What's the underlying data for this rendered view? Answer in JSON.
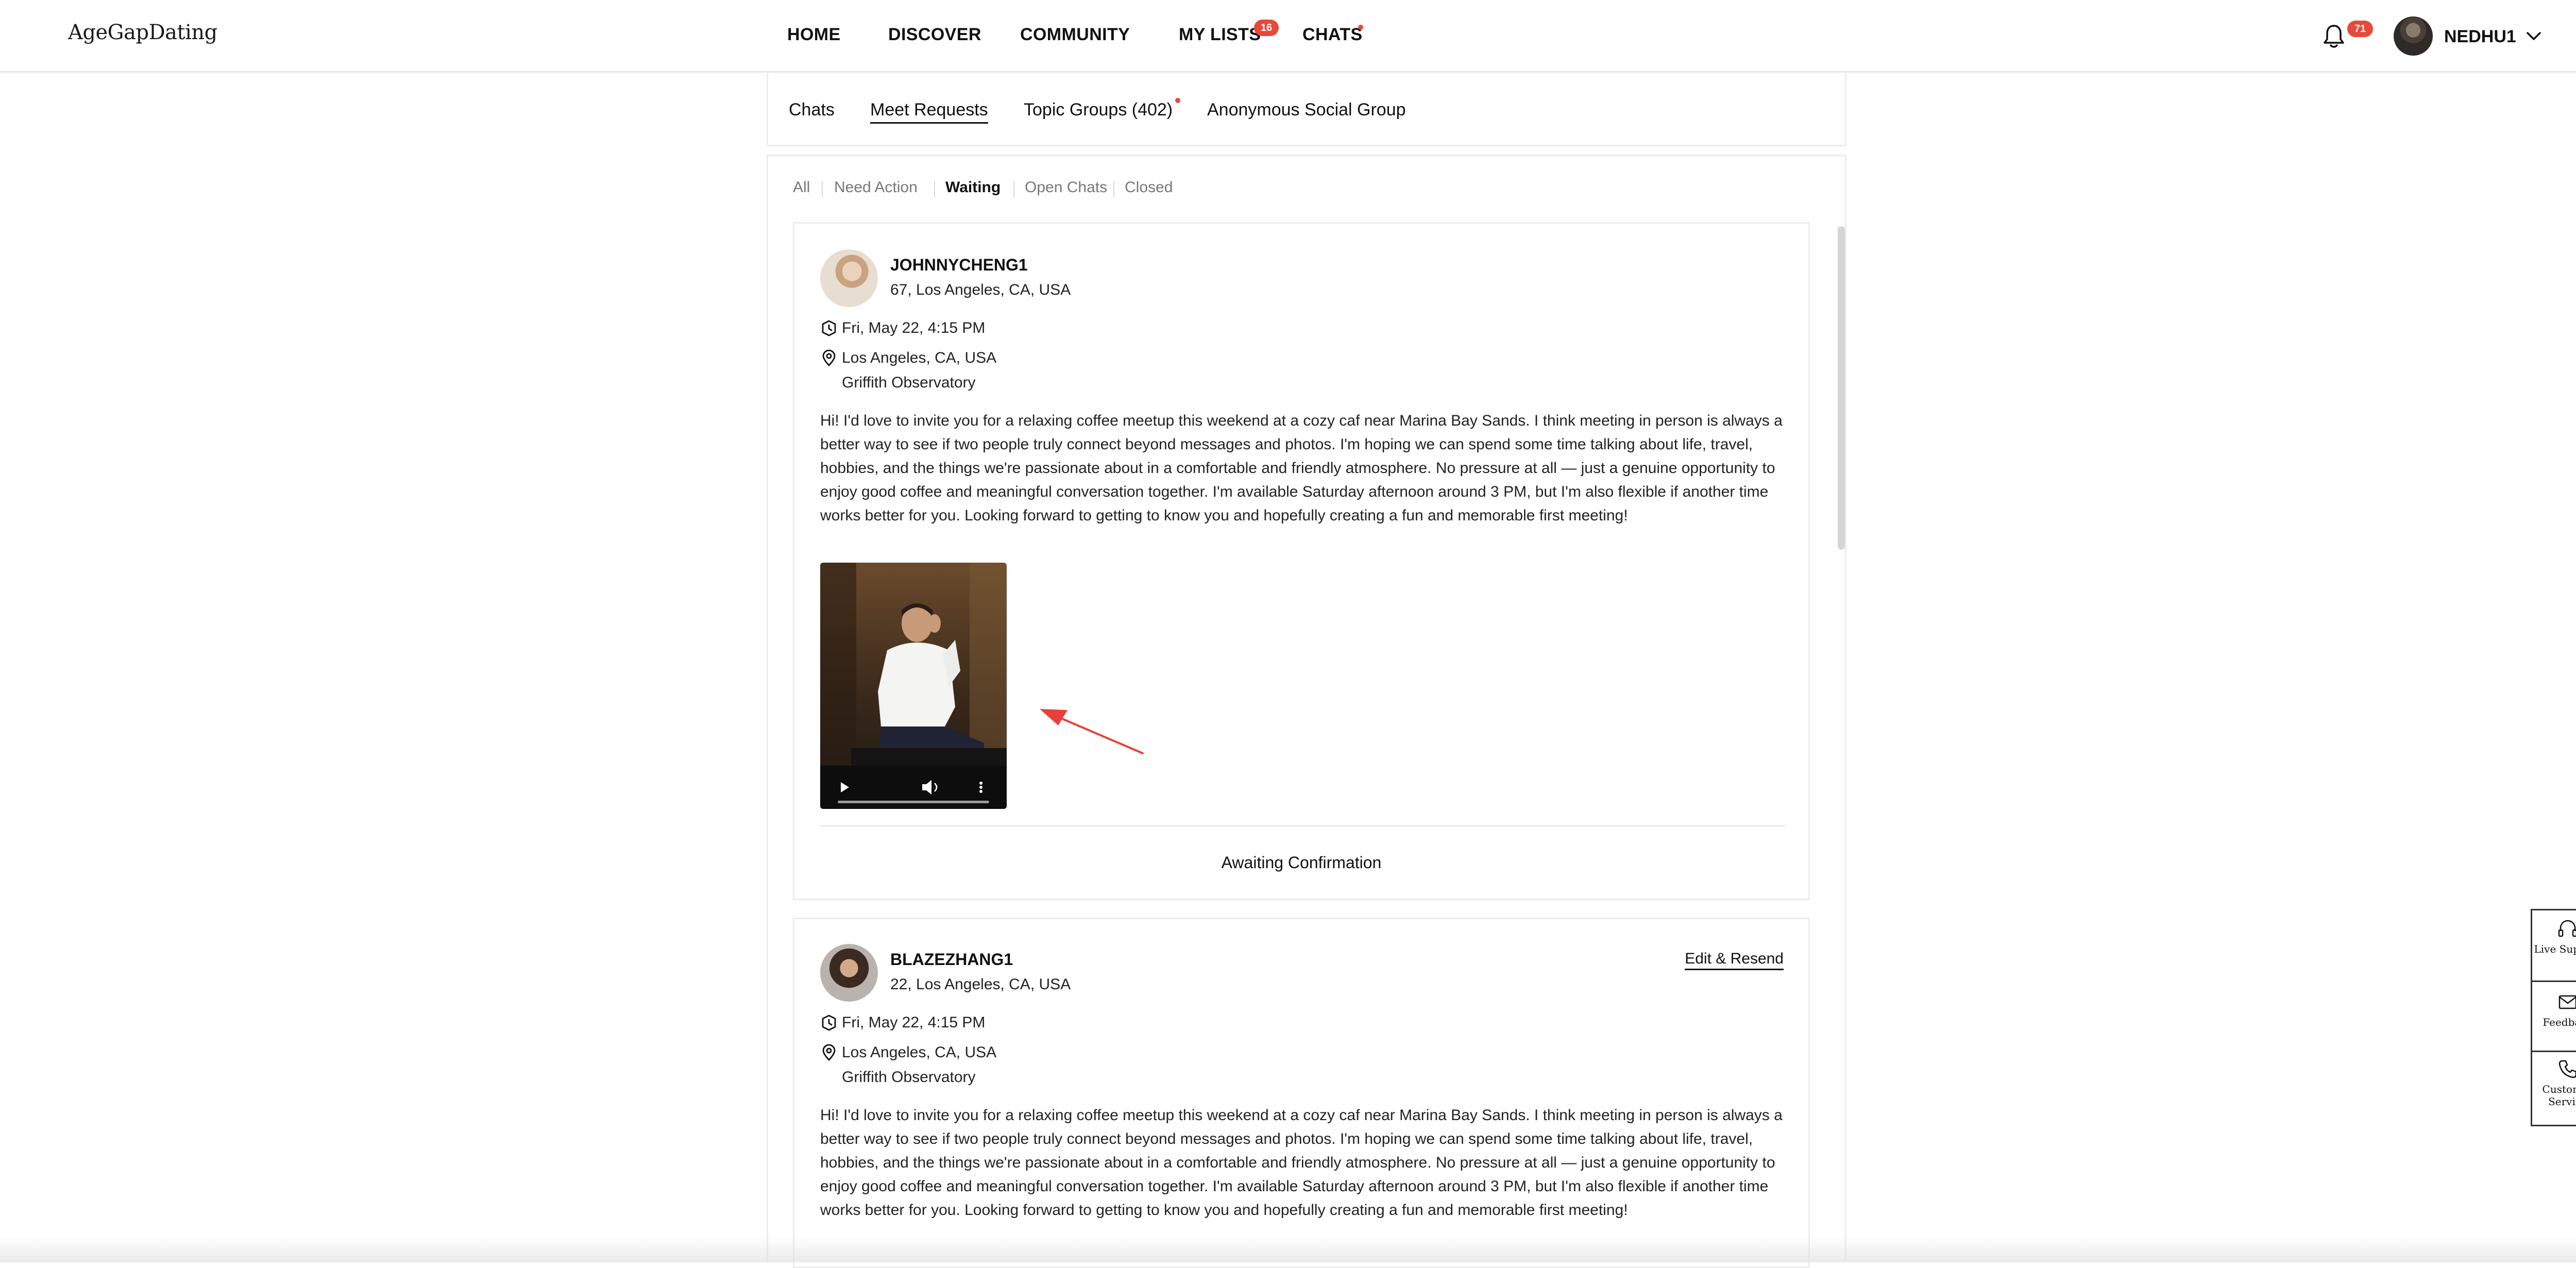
{
  "header": {
    "logo": "AgeGapDating",
    "nav": [
      {
        "label": "HOME"
      },
      {
        "label": "DISCOVER"
      },
      {
        "label": "COMMUNITY"
      },
      {
        "label": "MY LISTS",
        "badge": "16"
      },
      {
        "label": "CHATS",
        "dot": true
      }
    ],
    "notifications_badge": "71",
    "username": "NEDHU1"
  },
  "subtabs": [
    {
      "label": "Chats"
    },
    {
      "label": "Meet Requests",
      "active": true
    },
    {
      "label": "Topic Groups (402)",
      "dot": true
    },
    {
      "label": "Anonymous Social Group"
    }
  ],
  "filters": [
    {
      "label": "All"
    },
    {
      "label": "Need Action"
    },
    {
      "label": "Waiting",
      "active": true
    },
    {
      "label": "Open Chats"
    },
    {
      "label": "Closed"
    }
  ],
  "requests": [
    {
      "username": "JOHNNYCHENG1",
      "meta": "67, Los Angeles, CA, USA",
      "datetime": "Fri, May 22, 4:15 PM",
      "location": "Los Angeles, CA, USA",
      "venue": "Griffith Observatory",
      "message": "Hi! I'd love to invite you for a relaxing coffee meetup this weekend at a cozy caf near Marina Bay Sands. I think meeting in person is always a better way to see if two people truly connect beyond messages and photos. I'm hoping we can spend some time talking about life, travel, hobbies, and the things we're passionate about in a comfortable and friendly atmosphere. No pressure at all — just a genuine opportunity to enjoy good coffee and meaningful conversation together. I'm available Saturday afternoon around 3 PM, but I'm also flexible if another time works better for you. Looking forward to getting to know you and hopefully creating a fun and memorable first meeting!",
      "status": "Awaiting Confirmation"
    },
    {
      "username": "BLAZEZHANG1",
      "meta": "22, Los Angeles, CA, USA",
      "datetime": "Fri, May 22, 4:15 PM",
      "location": "Los Angeles, CA, USA",
      "venue": "Griffith Observatory",
      "action": "Edit & Resend",
      "message": "Hi! I'd love to invite you for a relaxing coffee meetup this weekend at a cozy caf near Marina Bay Sands. I think meeting in person is always a better way to see if two people truly connect beyond messages and photos. I'm hoping we can spend some time talking about life, travel, hobbies, and the things we're passionate about in a comfortable and friendly atmosphere. No pressure at all — just a genuine opportunity to enjoy good coffee and meaningful conversation together. I'm available Saturday afternoon around 3 PM, but I'm also flexible if another time works better for you. Looking forward to getting to know you and hopefully creating a fun and memorable first meeting!"
    }
  ],
  "side_widget": [
    {
      "label": "Live Support",
      "icon": "headset-icon"
    },
    {
      "label": "Feedback",
      "icon": "mail-icon"
    },
    {
      "label": "Customer Service",
      "icon": "phone-icon"
    }
  ],
  "colors": {
    "accent": "#e64a3b",
    "annotation_arrow": "#e8403a"
  }
}
